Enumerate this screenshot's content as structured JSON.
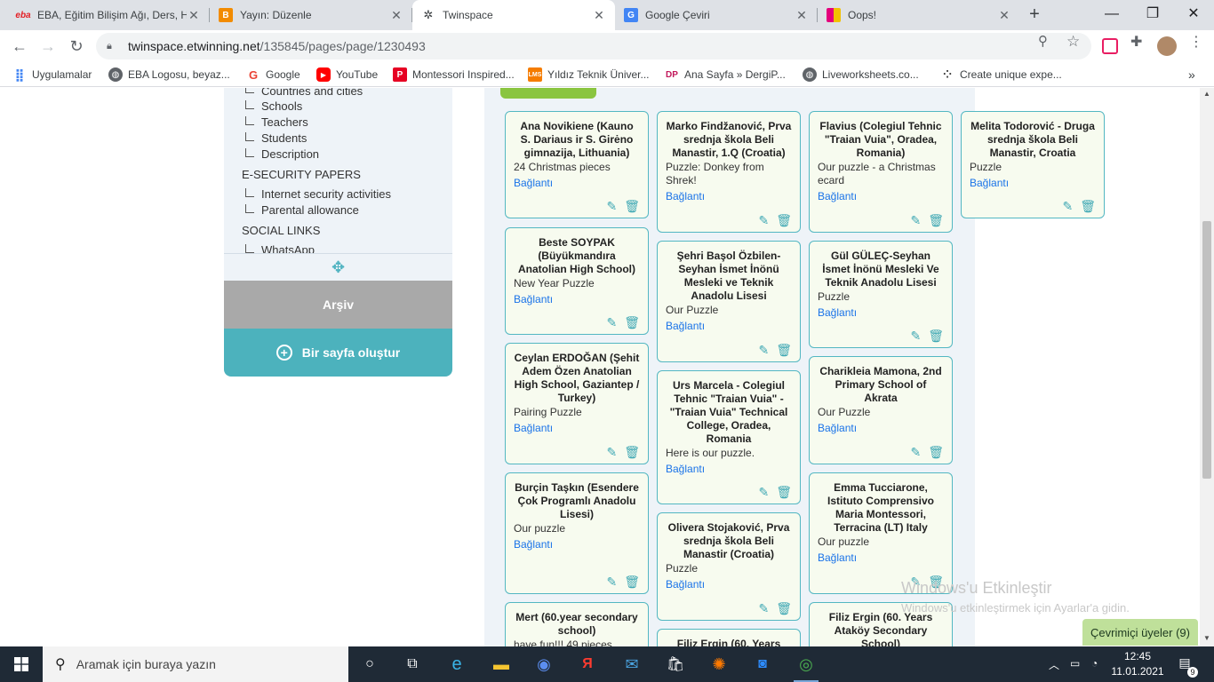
{
  "tabs": [
    {
      "title": "EBA, Eğitim Bilişim Ağı, Ders, Haber",
      "favicon": "eba",
      "color": "#e31e24"
    },
    {
      "title": "Yayın: Düzenle",
      "favicon": "B",
      "color": "#f28b00"
    },
    {
      "title": "Twinspace",
      "favicon": "twinspace",
      "color": "#3c4043"
    },
    {
      "title": "Google Çeviri",
      "favicon": "G",
      "color": "#4285f4"
    },
    {
      "title": "Oops!",
      "favicon": "oops",
      "color": "#8b2d86"
    }
  ],
  "address": {
    "host": "twinspace.etwinning.net",
    "path": "/135845/pages/page/1230493"
  },
  "bookmarks": [
    {
      "label": "Uygulamalar",
      "icon": "apps-icon"
    },
    {
      "label": "EBA Logosu, beyaz...",
      "icon": "globe-icon"
    },
    {
      "label": "Google",
      "icon": "google-icon"
    },
    {
      "label": "YouTube",
      "icon": "youtube-icon"
    },
    {
      "label": "Montessori Inspired...",
      "icon": "p-icon"
    },
    {
      "label": "Yıldız Teknik Üniver...",
      "icon": "ytu-icon"
    },
    {
      "label": "Ana Sayfa » DergiP...",
      "icon": "dp-icon"
    },
    {
      "label": "Liveworksheets.co...",
      "icon": "globe-icon"
    },
    {
      "label": "Create unique expe...",
      "icon": "dots-icon"
    }
  ],
  "sidebar": {
    "tree_items": [
      "Countries and cities",
      "Schools",
      "Teachers",
      "Students",
      "Description"
    ],
    "section_security": "E-SECURITY PAPERS",
    "security_items": [
      "Internet security activities",
      "Parental allowance"
    ],
    "section_social": "SOCIAL LINKS",
    "social_items": [
      "WhatsApp"
    ],
    "archive_label": "Arşiv",
    "create_label": "Bir sayfa oluştur"
  },
  "link_label": "Bağlantı",
  "cards": [
    {
      "title": "Ana Novikiene (Kauno S. Dariaus ir S. Girėno gimnazija, Lithuania)",
      "desc": "24 Christmas pieces"
    },
    {
      "title": "Beste SOYPAK (Büyükmandıra Anatolian High School)",
      "desc": "New Year Puzzle"
    },
    {
      "title": "Ceylan ERDOĞAN (Şehit Adem Özen Anatolian High School, Gaziantep / Turkey)",
      "desc": "Pairing Puzzle"
    },
    {
      "title": "Burçin Taşkın (Esendere Çok Programlı Anadolu Lisesi)",
      "desc": "Our puzzle"
    },
    {
      "title": "Mert (60.year secondary school)",
      "desc": "have fun!!! 49 pieces"
    },
    {
      "title": "Marko Findžanović, Prva srednja škola Beli Manastir, 1.Q (Croatia)",
      "desc": "Puzzle: Donkey from Shrek!"
    },
    {
      "title": "Şehri Başol Özbilen-Seyhan İsmet İnönü Mesleki ve Teknik Anadolu Lisesi",
      "desc": "Our Puzzle"
    },
    {
      "title": "Urs Marcela - Colegiul Tehnic \"Traian Vuia\" - \"Traian Vuia\" Technical College, Oradea, Romania",
      "desc": "Here is our puzzle."
    },
    {
      "title": "Olivera Stojaković, Prva srednja škola Beli Manastir (Croatia)",
      "desc": "Puzzle"
    },
    {
      "title": "Filiz Ergin (60. Years",
      "desc": ""
    },
    {
      "title": "Flavius (Colegiul Tehnic \"Traian Vuia\", Oradea, Romania)",
      "desc": "Our puzzle - a Christmas ecard"
    },
    {
      "title": "Gül GÜLEÇ-Seyhan İsmet İnönü Mesleki Ve Teknik Anadolu Lisesi",
      "desc": "Puzzle"
    },
    {
      "title": "Charikleia Mamona, 2nd Primary School of Akrata",
      "desc": "Our Puzzle"
    },
    {
      "title": "Emma Tucciarone, Istituto Comprensivo Maria Montessori, Terracina (LT) Italy",
      "desc": "Our puzzle"
    },
    {
      "title": "Filiz Ergin (60. Years Ataköy Secondary School)",
      "desc": ""
    },
    {
      "title": "Melita Todorović - Druga srednja škola Beli Manastir, Croatia",
      "desc": "Puzzle"
    }
  ],
  "watermark": {
    "title": "Windows'u Etkinleştir",
    "subtitle": "Windows'u etkinleştirmek için Ayarlar'a gidin."
  },
  "online_members": "Çevrimiçi üyeler (9)",
  "taskbar": {
    "search_placeholder": "Aramak için buraya yazın",
    "time": "12:45",
    "date": "11.01.2021",
    "notifications": "9"
  }
}
